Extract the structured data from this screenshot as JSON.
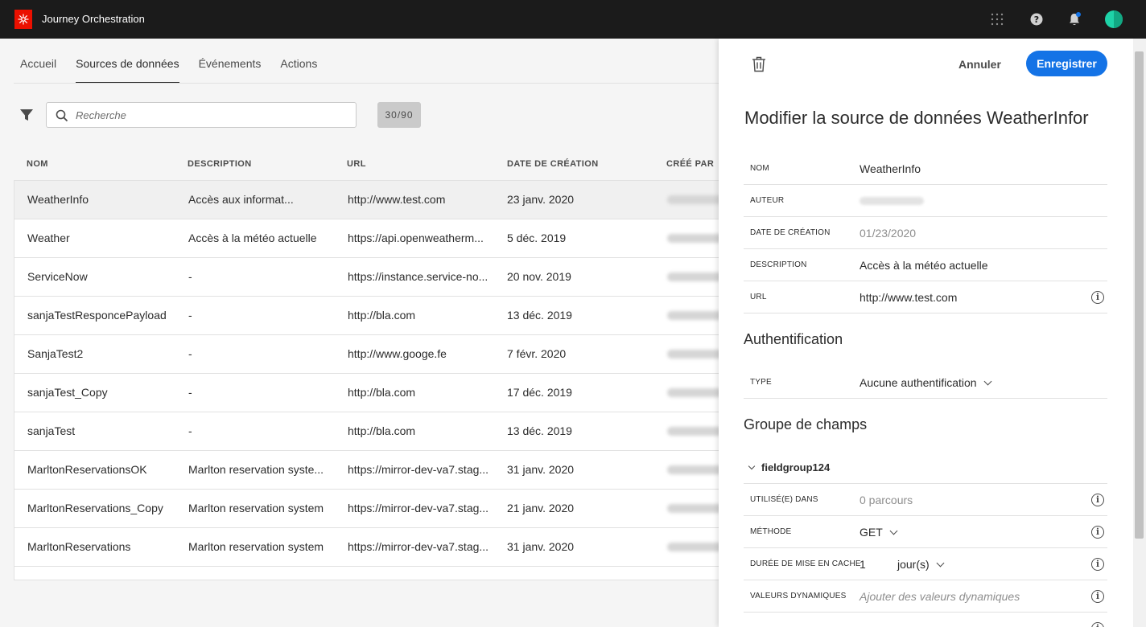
{
  "app": {
    "title": "Journey Orchestration"
  },
  "colors": {
    "accent": "#1473e6",
    "brand": "#eb1000",
    "topbar": "#1b1b1b",
    "notification": "#1473e6",
    "avatar": "#1ed3a8"
  },
  "icons": {
    "logo": "adobe-logo-icon",
    "apps": "apps-grid-icon",
    "help": "help-icon",
    "notifications": "bell-icon",
    "avatar": "avatar-icon",
    "filter": "filter-icon",
    "search": "search-icon",
    "trash": "trash-icon",
    "info": "info-icon"
  },
  "tabs": [
    {
      "label": "Accueil"
    },
    {
      "label": "Sources de données",
      "active": true
    },
    {
      "label": "Événements"
    },
    {
      "label": "Actions"
    }
  ],
  "search": {
    "placeholder": "Recherche",
    "value": ""
  },
  "count": "30/90",
  "table": {
    "columns": [
      "NOM",
      "DESCRIPTION",
      "URL",
      "DATE DE CRÉATION",
      "CRÉÉ PAR"
    ],
    "rows": [
      {
        "name": "WeatherInfo",
        "description": "Accès aux informat...",
        "url": "http://www.test.com",
        "date": "23 janv. 2020",
        "selected": true
      },
      {
        "name": "Weather",
        "description": "Accès à la météo actuelle",
        "url": "https://api.openweatherm...",
        "date": "5 déc. 2019"
      },
      {
        "name": "ServiceNow",
        "description": "-",
        "url": "https://instance.service-no...",
        "date": "20 nov. 2019"
      },
      {
        "name": "sanjaTestResponcePayload",
        "description": "-",
        "url": "http://bla.com",
        "date": "13 déc. 2019"
      },
      {
        "name": "SanjaTest2",
        "description": "-",
        "url": "http://www.googe.fe",
        "date": "7 févr. 2020"
      },
      {
        "name": "sanjaTest_Copy",
        "description": "-",
        "url": "http://bla.com",
        "date": "17 déc. 2019"
      },
      {
        "name": "sanjaTest",
        "description": "-",
        "url": "http://bla.com",
        "date": "13 déc. 2019"
      },
      {
        "name": "MarltonReservationsOK",
        "description": "Marlton reservation syste...",
        "url": "https://mirror-dev-va7.stag...",
        "date": "31 janv. 2020"
      },
      {
        "name": "MarltonReservations_Copy",
        "description": "Marlton reservation system",
        "url": "https://mirror-dev-va7.stag...",
        "date": "21 janv. 2020"
      },
      {
        "name": "MarltonReservations",
        "description": "Marlton reservation system",
        "url": "https://mirror-dev-va7.stag...",
        "date": "31 janv. 2020"
      }
    ]
  },
  "panel": {
    "cancel_label": "Annuler",
    "save_label": "Enregistrer",
    "title": "Modifier la source de données WeatherInfor",
    "fields": {
      "name": {
        "label": "NOM",
        "value": "WeatherInfo"
      },
      "author": {
        "label": "AUTEUR"
      },
      "created": {
        "label": "DATE DE CRÉATION",
        "value": "01/23/2020"
      },
      "description": {
        "label": "DESCRIPTION",
        "value": "Accès à la météo actuelle"
      },
      "url": {
        "label": "URL",
        "value": "http://www.test.com"
      }
    },
    "auth": {
      "section_title": "Authentification",
      "type_label": "TYPE",
      "type_value": "Aucune authentification"
    },
    "fieldgroups": {
      "section_title": "Groupe de champs",
      "group_name": "fieldgroup124",
      "used_in_label": "UTILISÉ(E) DANS",
      "used_in_value": "0 parcours",
      "method_label": "MÉTHODE",
      "method_value": "GET",
      "cache_label": "DURÉE DE MISE EN CACHE",
      "cache_value": "1",
      "cache_unit": "jour(s)",
      "dynamic_label": "VALEURS DYNAMIQUES",
      "dynamic_placeholder": "Ajouter des valeurs dynamiques"
    }
  }
}
